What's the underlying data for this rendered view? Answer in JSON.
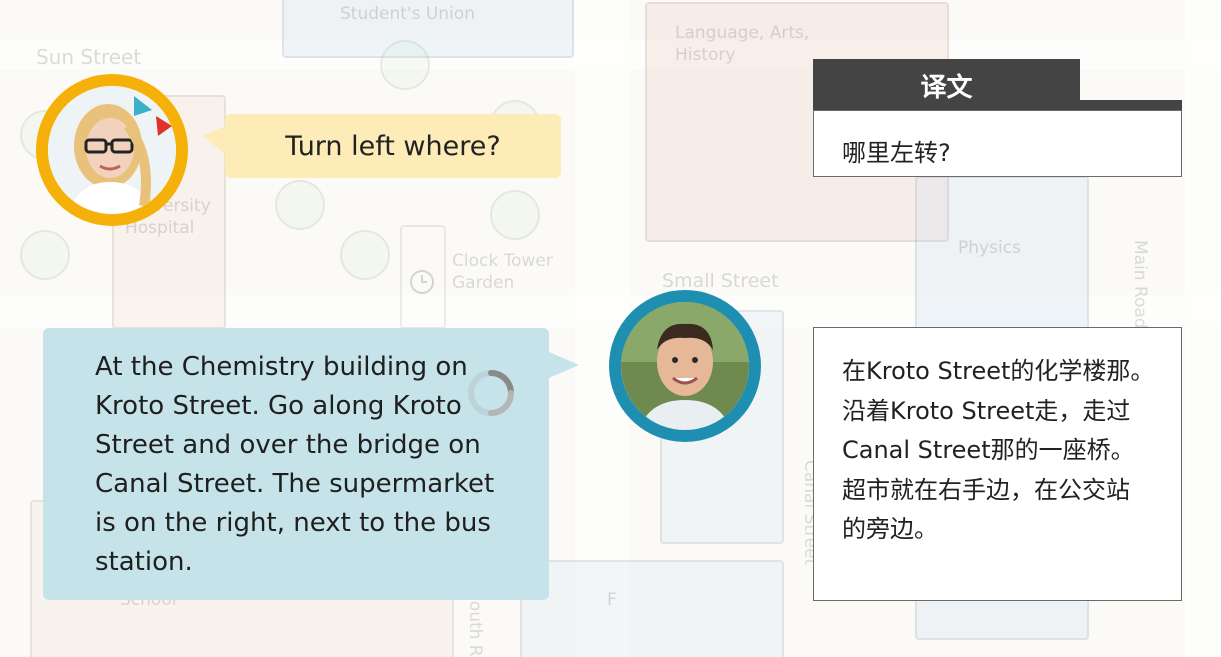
{
  "map": {
    "labels": {
      "sun_street": "Sun Street",
      "students_union": "Student's Union",
      "language_arts_history": "Language, Arts, History",
      "university_hospital": "University Hospital",
      "clock_tower_garden": "Clock Tower Garden",
      "small_street": "Small Street",
      "physics": "Physics",
      "main_road": "Main Road",
      "canal_street": "Canal Street",
      "school": "School",
      "south_road": "South R",
      "f": "F"
    }
  },
  "dialogue": {
    "question": "Turn left where?",
    "answer_lines": [
      "At the Chemistry building on",
      "Kroto Street. Go along Kroto",
      "Street and over the bridge on",
      "Canal Street. The supermarket",
      "is on the right, next to the bus",
      "station."
    ]
  },
  "translation": {
    "tab_label": "译文",
    "question": "哪里左转?",
    "answer_lines": [
      "在Kroto Street的化学楼那。",
      "沿着Kroto Street走，走过",
      "Canal Street那的一座桥。",
      "超市就在右手边，在公交站",
      "的旁边。"
    ]
  },
  "colors": {
    "yellow_ring": "#f5b10a",
    "blue_ring": "#1e8fb0",
    "yellow_bubble": "#fdebb8",
    "blue_bubble": "#c7e3ea",
    "tab_dark": "#444444"
  },
  "icons": [
    "loading-spinner-icon",
    "clock-icon"
  ]
}
